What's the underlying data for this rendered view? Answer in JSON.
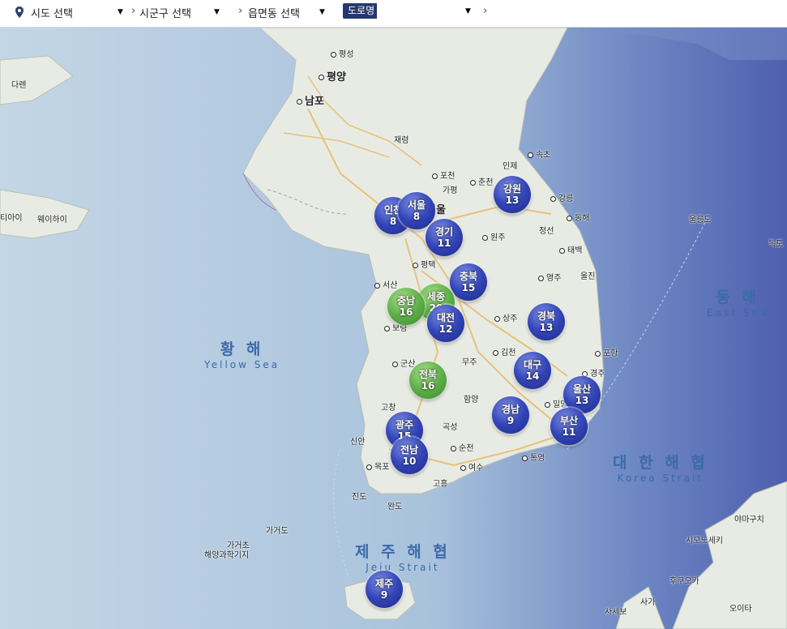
{
  "toolbar": {
    "sido": "시도 선택",
    "sigungu": "시군구 선택",
    "eupmyeondong": "읍면동 선택",
    "road_label": "도로명",
    "icons": {
      "location": "map-pin-icon",
      "dropdown": "caret-down-icon",
      "breadcrumb": "chevron-right-icon"
    }
  },
  "seas": {
    "yellow_ko": "황 해",
    "yellow_en": "Yellow Sea",
    "east_ko": "동 해",
    "east_en": "East Sea",
    "korea_ko": "대 한 해 협",
    "korea_en": "Korea Strait",
    "jeju_ko": "제 주 해 협",
    "jeju_en": "Jeju Strait"
  },
  "places": {
    "pyongsong": "평성",
    "pyongyang": "평양",
    "nampo": "남포",
    "dalian": "다렌",
    "jaeryong": "재령",
    "pocheon": "포천",
    "chuncheon": "춘천",
    "gapyeong": "가평",
    "inje": "인제",
    "sokcho": "속초",
    "gangneung": "강릉",
    "donghae": "동해",
    "seoul": "서울",
    "wonju": "원주",
    "jeongseon": "정선",
    "taebaek": "태백",
    "pyeongtaek": "평택",
    "seosan": "서산",
    "yeongju": "영주",
    "uljin": "울진",
    "boryeong": "보령",
    "sangju": "상주",
    "gimcheon": "김천",
    "pohang": "포항",
    "gunsan": "군산",
    "muju": "무주",
    "gyeongju": "경주",
    "gochang": "고창",
    "hamyang": "함양",
    "miryang": "밀양",
    "goseong": "곡성",
    "suncheon": "순천",
    "tongyeong": "통영",
    "sinan": "신안",
    "mokpo": "목포",
    "yeosu": "여수",
    "goheung": "고흥",
    "jindo": "진도",
    "wando": "완도",
    "ulleungdo": "울릉도",
    "dokdo": "독도",
    "tianjin": "티아이",
    "weihai": "웨이하이",
    "gageodo": "가거도",
    "gageocho": "가거초",
    "gageocho2": "해양과학기지",
    "yamaguchi": "야마구치",
    "shimonoseki": "시모노세키",
    "kurume": "후쿠오카",
    "saga": "사가",
    "sasebo": "사세보",
    "oita": "오이타"
  },
  "clusters": [
    {
      "name": "인천",
      "count": "8",
      "color": "#3345b8"
    },
    {
      "name": "서울",
      "count": "8",
      "color": "#3345b8"
    },
    {
      "name": "강원",
      "count": "13",
      "color": "#3345b8"
    },
    {
      "name": "경기",
      "count": "11",
      "color": "#3345b8"
    },
    {
      "name": "충북",
      "count": "15",
      "color": "#3345b8"
    },
    {
      "name": "세종",
      "count": "20",
      "color": "#5eb149"
    },
    {
      "name": "충남",
      "count": "16",
      "color": "#5eb149"
    },
    {
      "name": "대전",
      "count": "12",
      "color": "#3345b8"
    },
    {
      "name": "경북",
      "count": "13",
      "color": "#3345b8"
    },
    {
      "name": "대구",
      "count": "14",
      "color": "#3345b8"
    },
    {
      "name": "전북",
      "count": "16",
      "color": "#5eb149"
    },
    {
      "name": "울산",
      "count": "13",
      "color": "#3345b8"
    },
    {
      "name": "경남",
      "count": "9",
      "color": "#3345b8"
    },
    {
      "name": "부산",
      "count": "11",
      "color": "#3345b8"
    },
    {
      "name": "광주",
      "count": "15",
      "color": "#3345b8"
    },
    {
      "name": "전남",
      "count": "10",
      "color": "#3345b8"
    },
    {
      "name": "제주",
      "count": "9",
      "color": "#3345b8"
    }
  ]
}
